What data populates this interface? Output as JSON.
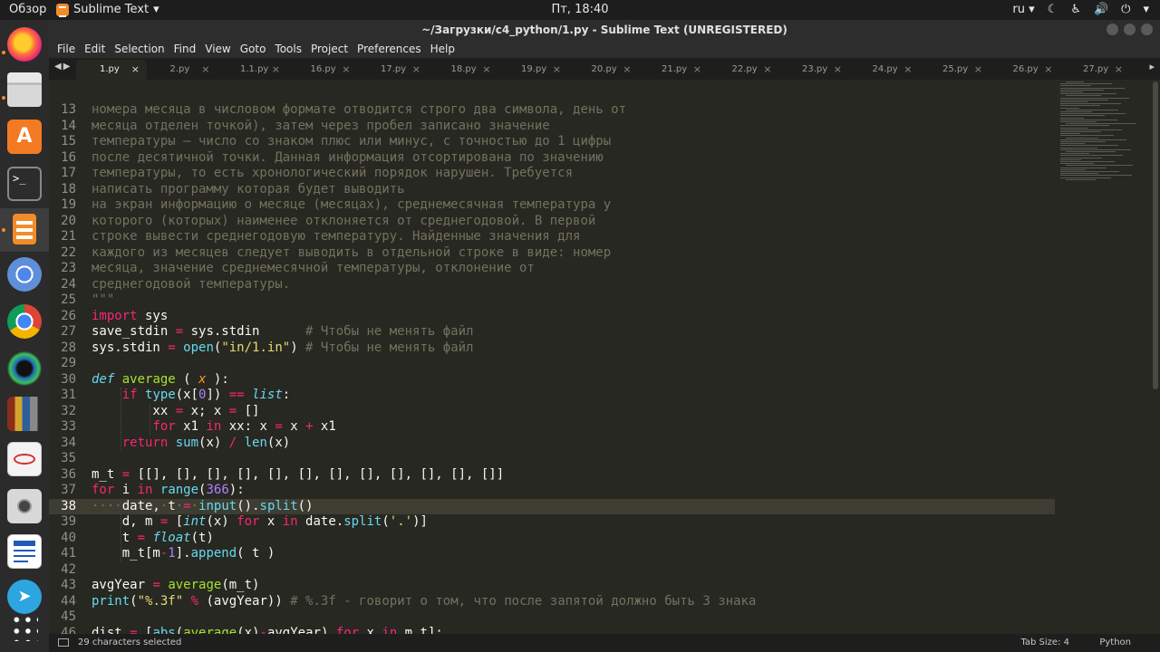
{
  "topbar": {
    "activities": "Обзор",
    "app_name": "Sublime Text",
    "clock": "Пт, 18:40",
    "lang": "ru"
  },
  "window": {
    "title": "~/Загрузки/c4_python/1.py - Sublime Text (UNREGISTERED)"
  },
  "menu": [
    "File",
    "Edit",
    "Selection",
    "Find",
    "View",
    "Goto",
    "Tools",
    "Project",
    "Preferences",
    "Help"
  ],
  "tabs": [
    "1.py",
    "2.py",
    "1.1.py",
    "16.py",
    "17.py",
    "18.py",
    "19.py",
    "20.py",
    "21.py",
    "22.py",
    "23.py",
    "24.py",
    "25.py",
    "26.py",
    "27.py"
  ],
  "active_tab": "1.py",
  "status": {
    "selection": "29 characters selected",
    "tab_size": "Tab Size: 4",
    "syntax": "Python"
  },
  "colors": {
    "background": "#272822",
    "keyword": "#f92672",
    "function": "#a6e22e",
    "builtin": "#66d9ef",
    "string": "#e6db74",
    "number": "#ae81ff",
    "comment": "#75715e"
  },
  "dock_icons": [
    "firefox-icon",
    "files-icon",
    "software-center-icon",
    "terminal-icon",
    "sublime-text-icon",
    "chromium-icon",
    "chrome-icon",
    "ubuntu-icon",
    "calibre-icon",
    "evince-icon",
    "screenshot-icon",
    "libreoffice-writer-icon",
    "telegram-icon",
    "apps-grid-icon"
  ],
  "code_lines": [
    {
      "n": "13",
      "t": [
        [
          "c-com",
          "номера месяца в числовом формате отводится строго два символа, день от"
        ]
      ]
    },
    {
      "n": "14",
      "t": [
        [
          "c-com",
          "месяца отделен точкой), затем через пробел записано значение"
        ]
      ]
    },
    {
      "n": "15",
      "t": [
        [
          "c-com",
          "температуры — число со знаком плюс или минус, с точностью до 1 цифры"
        ]
      ]
    },
    {
      "n": "16",
      "t": [
        [
          "c-com",
          "после десятичной точки. Данная информация отсортирована по значению"
        ]
      ]
    },
    {
      "n": "17",
      "t": [
        [
          "c-com",
          "температуры, то есть хронологический порядок нарушен. Требуется"
        ]
      ]
    },
    {
      "n": "18",
      "t": [
        [
          "c-com",
          "написать программу которая будет выводить"
        ]
      ]
    },
    {
      "n": "19",
      "t": [
        [
          "c-com",
          "на экран информацию о месяце (месяцах), среднемесячная температура у"
        ]
      ]
    },
    {
      "n": "20",
      "t": [
        [
          "c-com",
          "которого (которых) наименее отклоняется от среднегодовой. В первой"
        ]
      ]
    },
    {
      "n": "21",
      "t": [
        [
          "c-com",
          "строке вывести среднегодовую температуру. Найденные значения для"
        ]
      ]
    },
    {
      "n": "22",
      "t": [
        [
          "c-com",
          "каждого из месяцев следует выводить в отдельной строке в виде: номер"
        ]
      ]
    },
    {
      "n": "23",
      "t": [
        [
          "c-com",
          "месяца, значение среднемесячной температуры, отклонение от"
        ]
      ]
    },
    {
      "n": "24",
      "t": [
        [
          "c-com",
          "среднегодовой температуры."
        ]
      ]
    },
    {
      "n": "25",
      "t": [
        [
          "c-com",
          "\"\"\""
        ]
      ]
    },
    {
      "n": "26",
      "t": [
        [
          "c-kw",
          "import"
        ],
        [
          "",
          " sys"
        ]
      ]
    },
    {
      "n": "27",
      "t": [
        [
          "",
          "save_stdin "
        ],
        [
          "c-kw",
          "="
        ],
        [
          "",
          " sys.stdin      "
        ],
        [
          "c-com",
          "# Чтобы не менять файл"
        ]
      ]
    },
    {
      "n": "28",
      "t": [
        [
          "",
          "sys.stdin "
        ],
        [
          "c-kw",
          "="
        ],
        [
          "",
          " "
        ],
        [
          "c-bi",
          "open"
        ],
        [
          "",
          "("
        ],
        [
          "c-str",
          "\"in/1.in\""
        ],
        [
          "",
          ") "
        ],
        [
          "c-com",
          "# Чтобы не менять файл"
        ]
      ]
    },
    {
      "n": "29",
      "t": []
    },
    {
      "n": "30",
      "t": [
        [
          "c-it",
          "def"
        ],
        [
          "",
          " "
        ],
        [
          "c-fn",
          "average"
        ],
        [
          "",
          " ( "
        ],
        [
          "c-arg",
          "x"
        ],
        [
          "",
          " ):"
        ]
      ]
    },
    {
      "n": "31",
      "t": [
        [
          "",
          "    "
        ],
        [
          "c-kw",
          "if"
        ],
        [
          "",
          " "
        ],
        [
          "c-bi",
          "type"
        ],
        [
          "",
          "(x["
        ],
        [
          "c-num",
          "0"
        ],
        [
          "",
          "]) "
        ],
        [
          "c-kw",
          "=="
        ],
        [
          "",
          " "
        ],
        [
          "c-it",
          "list"
        ],
        [
          "",
          ":"
        ]
      ]
    },
    {
      "n": "32",
      "t": [
        [
          "",
          "        xx "
        ],
        [
          "c-kw",
          "="
        ],
        [
          "",
          " x; x "
        ],
        [
          "c-kw",
          "="
        ],
        [
          "",
          " []"
        ]
      ]
    },
    {
      "n": "33",
      "t": [
        [
          "",
          "        "
        ],
        [
          "c-kw",
          "for"
        ],
        [
          "",
          " x1 "
        ],
        [
          "c-kw",
          "in"
        ],
        [
          "",
          " xx: x "
        ],
        [
          "c-kw",
          "="
        ],
        [
          "",
          " x "
        ],
        [
          "c-kw",
          "+"
        ],
        [
          "",
          " x1"
        ]
      ]
    },
    {
      "n": "34",
      "t": [
        [
          "",
          "    "
        ],
        [
          "c-kw",
          "return"
        ],
        [
          "",
          " "
        ],
        [
          "c-bi",
          "sum"
        ],
        [
          "",
          "(x) "
        ],
        [
          "c-kw",
          "/"
        ],
        [
          "",
          " "
        ],
        [
          "c-bi",
          "len"
        ],
        [
          "",
          "(x)"
        ]
      ]
    },
    {
      "n": "35",
      "t": []
    },
    {
      "n": "36",
      "t": [
        [
          "",
          "m_t "
        ],
        [
          "c-kw",
          "="
        ],
        [
          "",
          " [[], [], [], [], [], [], [], [], [], [], [], []]"
        ]
      ]
    },
    {
      "n": "37",
      "t": [
        [
          "c-kw",
          "for"
        ],
        [
          "",
          " i "
        ],
        [
          "c-kw",
          "in"
        ],
        [
          "",
          " "
        ],
        [
          "c-bi",
          "range"
        ],
        [
          "",
          "("
        ],
        [
          "c-num",
          "366"
        ],
        [
          "",
          "):"
        ]
      ]
    },
    {
      "n": "38",
      "t": [
        [
          "c-com",
          "····"
        ],
        [
          "",
          "date,"
        ],
        [
          "c-com",
          "·"
        ],
        [
          "",
          "t"
        ],
        [
          "c-com",
          "·"
        ],
        [
          "c-kw",
          "="
        ],
        [
          "c-com",
          "·"
        ],
        [
          "c-bi",
          "input"
        ],
        [
          "",
          "()."
        ],
        [
          "c-bi",
          "split"
        ],
        [
          "",
          "()"
        ]
      ],
      "cur": true
    },
    {
      "n": "39",
      "t": [
        [
          "",
          "    d, m "
        ],
        [
          "c-kw",
          "="
        ],
        [
          "",
          " ["
        ],
        [
          "c-it",
          "int"
        ],
        [
          "",
          "(x) "
        ],
        [
          "c-kw",
          "for"
        ],
        [
          "",
          " x "
        ],
        [
          "c-kw",
          "in"
        ],
        [
          "",
          " date."
        ],
        [
          "c-bi",
          "split"
        ],
        [
          "",
          "("
        ],
        [
          "c-str",
          "'.'"
        ],
        [
          "",
          ")]"
        ]
      ]
    },
    {
      "n": "40",
      "t": [
        [
          "",
          "    t "
        ],
        [
          "c-kw",
          "="
        ],
        [
          "",
          " "
        ],
        [
          "c-it",
          "float"
        ],
        [
          "",
          "(t)"
        ]
      ]
    },
    {
      "n": "41",
      "t": [
        [
          "",
          "    m_t[m"
        ],
        [
          "c-kw",
          "-"
        ],
        [
          "c-num",
          "1"
        ],
        [
          "",
          "]."
        ],
        [
          "c-bi",
          "append"
        ],
        [
          "",
          "( t )"
        ]
      ]
    },
    {
      "n": "42",
      "t": []
    },
    {
      "n": "43",
      "t": [
        [
          "",
          "avgYear "
        ],
        [
          "c-kw",
          "="
        ],
        [
          "",
          " "
        ],
        [
          "c-fn",
          "average"
        ],
        [
          "",
          "(m_t)"
        ]
      ]
    },
    {
      "n": "44",
      "t": [
        [
          "c-bi",
          "print"
        ],
        [
          "",
          "("
        ],
        [
          "c-str",
          "\"%.3f\""
        ],
        [
          "",
          " "
        ],
        [
          "c-kw",
          "%"
        ],
        [
          "",
          " (avgYear)) "
        ],
        [
          "c-com",
          "# %.3f - говорит о том, что после запятой должно быть 3 знака"
        ]
      ]
    },
    {
      "n": "45",
      "t": []
    },
    {
      "n": "46",
      "t": [
        [
          "",
          "dist "
        ],
        [
          "c-kw",
          "="
        ],
        [
          "",
          " ["
        ],
        [
          "c-bi",
          "abs"
        ],
        [
          "",
          "("
        ],
        [
          "c-fn",
          "average"
        ],
        [
          "",
          "(x)"
        ],
        [
          "c-kw",
          "-"
        ],
        [
          "",
          "avgYear) "
        ],
        [
          "c-kw",
          "for"
        ],
        [
          "",
          " x "
        ],
        [
          "c-kw",
          "in"
        ],
        [
          "",
          " m_t];"
        ]
      ]
    }
  ]
}
